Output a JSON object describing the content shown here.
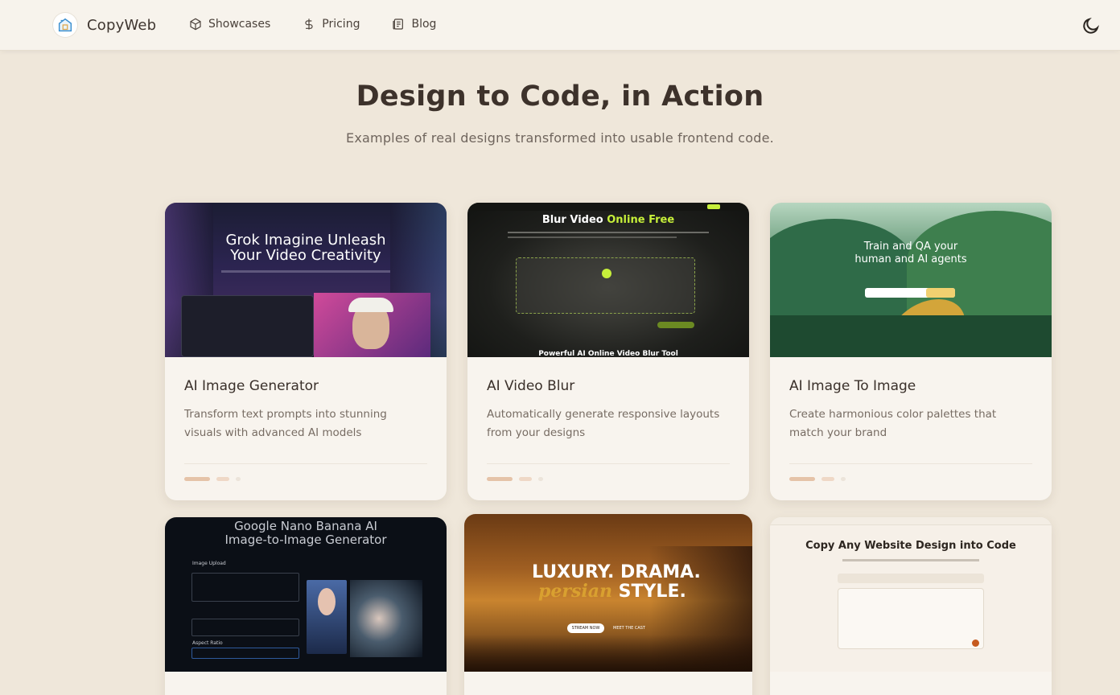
{
  "nav": {
    "brand": "CopyWeb",
    "links": [
      {
        "label": "Showcases",
        "icon": "cube-icon"
      },
      {
        "label": "Pricing",
        "icon": "dollar-icon"
      },
      {
        "label": "Blog",
        "icon": "newspaper-icon"
      }
    ],
    "theme_icon": "moon-icon"
  },
  "hero": {
    "title": "Design to Code, in Action",
    "subtitle": "Examples of real designs transformed into usable frontend code."
  },
  "cards": [
    {
      "title": "AI Image Generator",
      "description": "Transform text prompts into stunning visuals with advanced AI models",
      "thumb": {
        "headline_1": "Grok Imagine Unleash",
        "headline_2": "Your Video Creativity"
      }
    },
    {
      "title": "AI Video Blur",
      "description": "Automatically generate responsive layouts from your designs",
      "thumb": {
        "headline_1": "Blur Video",
        "headline_accent": "Online Free",
        "footer": "Powerful AI Online Video Blur Tool"
      }
    },
    {
      "title": "AI Image To Image",
      "description": "Create harmonious color palettes that match your brand",
      "thumb": {
        "headline_1": "Train and QA your",
        "headline_2": "human and AI agents"
      }
    },
    {
      "thumb": {
        "headline_1": "Google Nano Banana AI",
        "headline_2": "Image-to-Image Generator",
        "label_upload": "Image Upload",
        "label_ratio": "Aspect Ratio"
      }
    },
    {
      "thumb": {
        "headline_1": "LUXURY. DRAMA.",
        "headline_accent": "persian",
        "headline_2": "STYLE.",
        "btn_1": "STREAM NOW",
        "btn_2": "MEET THE CAST"
      }
    },
    {
      "thumb": {
        "headline_1": "Copy Any Website Design into Code"
      }
    }
  ],
  "colors": {
    "background": "#efe7da",
    "card": "#f8f4ee",
    "accent": "#e5c3a8"
  }
}
